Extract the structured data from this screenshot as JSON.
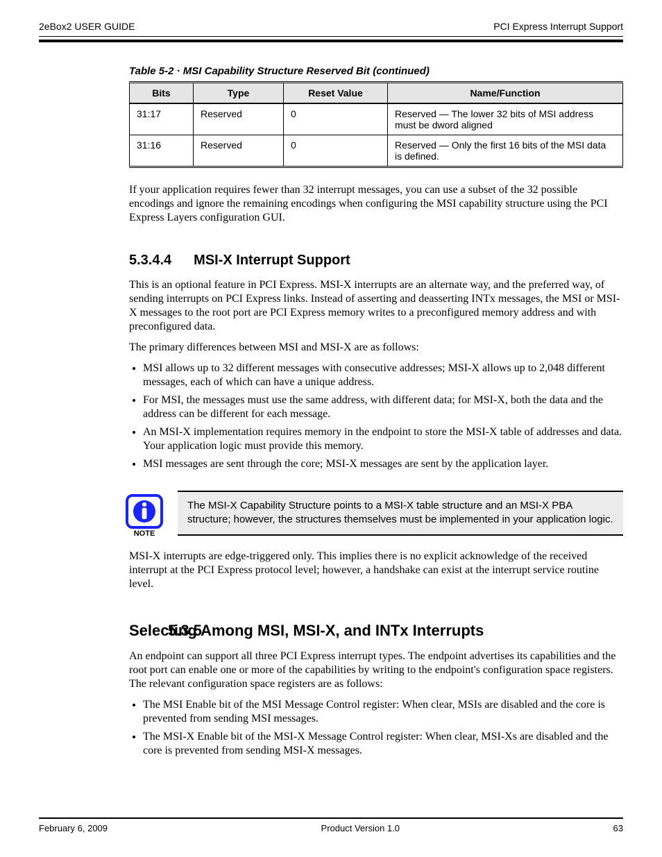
{
  "header": {
    "left": "2eBox2 USER GUIDE",
    "right": "PCI Express Interrupt Support"
  },
  "table": {
    "caption": "Table 5-2 · MSI Capability Structure Reserved Bit (continued)",
    "headers": [
      "Bits",
      "Type",
      "Reset Value",
      "Name/Function"
    ],
    "rows": [
      {
        "bits": "31:17",
        "type": "Reserved",
        "reset": "0",
        "name": "Reserved — The lower 32 bits of MSI address must be dword aligned"
      },
      {
        "bits": "31:16",
        "type": "Reserved",
        "reset": "0",
        "name": "Reserved — Only the first 16 bits of the MSI data is defined."
      }
    ]
  },
  "para_after_table": "If your application requires fewer than 32 interrupt messages, you can use a subset of the 32 possible encodings and ignore the remaining encodings when configuring the MSI capability structure using the PCI Express Layers configuration GUI.",
  "section_5344": {
    "num": "5.3.4.4",
    "title": "MSI-X Interrupt Support",
    "p1": "This is an optional feature in PCI Express. MSI-X interrupts are an alternate way, and the preferred way, of sending interrupts on PCI Express links. Instead of asserting and deasserting INTx messages, the MSI or MSI-X messages to the root port are PCI Express memory writes to a preconfigured memory address and with preconfigured data.",
    "p2": "The primary differences between MSI and MSI-X are as follows:",
    "bullets": [
      "MSI allows up to 32 different messages with consecutive addresses; MSI-X allows up to 2,048 different messages, each of which can have a unique address.",
      "For MSI, the messages must use the same address, with different data; for MSI-X, both the data and the address can be different for each message.",
      "An MSI-X implementation requires memory in the endpoint to store the MSI-X table of addresses and data. Your application logic must provide this memory.",
      "MSI messages are sent through the core; MSI-X messages are sent by the application layer."
    ]
  },
  "note": {
    "text": "The MSI-X Capability Structure points to a MSI-X table structure and an MSI-X PBA structure; however, the structures themselves must be implemented in your application logic."
  },
  "para_after_note": "MSI-X interrupts are edge-triggered only. This implies there is no explicit acknowledge of the received interrupt at the PCI Express protocol level; however, a handshake can exist at the interrupt service routine level.",
  "section_535": {
    "num": "5.3.5",
    "title": "Selecting Among MSI, MSI-X, and INTx Interrupts",
    "p1": "An endpoint can support all three PCI Express interrupt types. The endpoint advertises its capabilities and the root port can enable one or more of the capabilities by writing to the endpoint's configuration space registers. The relevant configuration space registers are as follows:",
    "bullets": [
      "The MSI Enable bit of the MSI Message Control register: When clear, MSIs are disabled and the core is prevented from sending MSI messages.",
      "The MSI-X Enable bit of the MSI-X Message Control register: When clear, MSI-Xs are disabled and the core is prevented from sending MSI-X messages."
    ]
  },
  "footer": {
    "left": "February 6, 2009",
    "center": "Product Version 1.0",
    "right": "63"
  },
  "icon_label": "NOTE"
}
